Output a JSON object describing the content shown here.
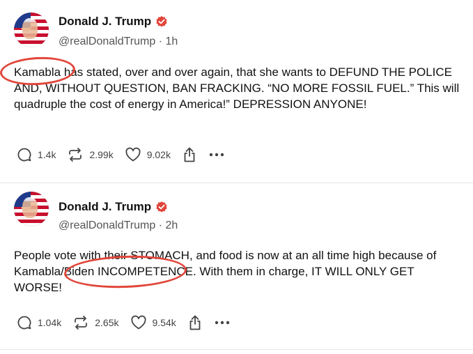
{
  "posts": [
    {
      "author": "Donald J. Trump",
      "handle": "@realDonaldTrump",
      "time": "1h",
      "text": "Kamabla has stated, over and over again, that she wants to DEFUND THE POLICE AND, WITHOUT QUESTION, BAN FRACKING. “NO MORE FOSSIL FUEL.” This will quadruple the cost of energy in America!” DEPRESSION ANYONE!",
      "replies": "1.4k",
      "retruths": "2.99k",
      "likes": "9.02k"
    },
    {
      "author": "Donald J. Trump",
      "handle": "@realDonaldTrump",
      "time": "2h",
      "text": "People vote with their STOMACH, and food is now at an all time high because of Kamabla/Biden INCOMPETENCE. With them in charge, IT WILL ONLY GET WORSE!",
      "replies": "1.04k",
      "retruths": "2.65k",
      "likes": "9.54k"
    }
  ],
  "colors": {
    "verified_badge": "#e1463b",
    "annotation_circle": "#e1463b",
    "handle_text": "#555555",
    "action_icons": "#444444"
  },
  "icons": [
    "verified-icon",
    "reply-icon",
    "retruth-icon",
    "like-icon",
    "share-icon",
    "more-icon"
  ]
}
